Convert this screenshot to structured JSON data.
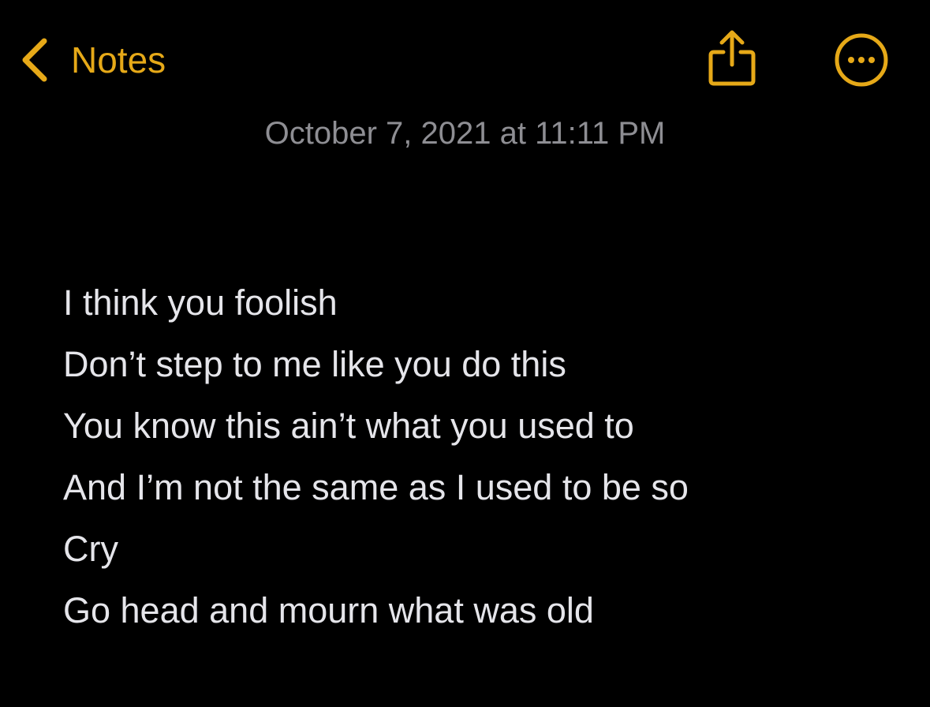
{
  "nav": {
    "back_label": "Notes",
    "back_icon": "chevron-left-icon",
    "share_icon": "share-icon",
    "more_icon": "ellipsis-circle-icon",
    "accent_color": "#E6A918"
  },
  "note": {
    "timestamp": "October 7, 2021 at 11:11 PM",
    "lines": [
      "I think you foolish",
      "Don’t step to me like you do this",
      "You know this ain’t what you used to",
      "And I’m not the same as I used to be so",
      "Cry",
      "Go head and mourn what was old"
    ]
  },
  "colors": {
    "background": "#000000",
    "text": "#E5E5EA",
    "secondary_text": "#8E8E93"
  }
}
